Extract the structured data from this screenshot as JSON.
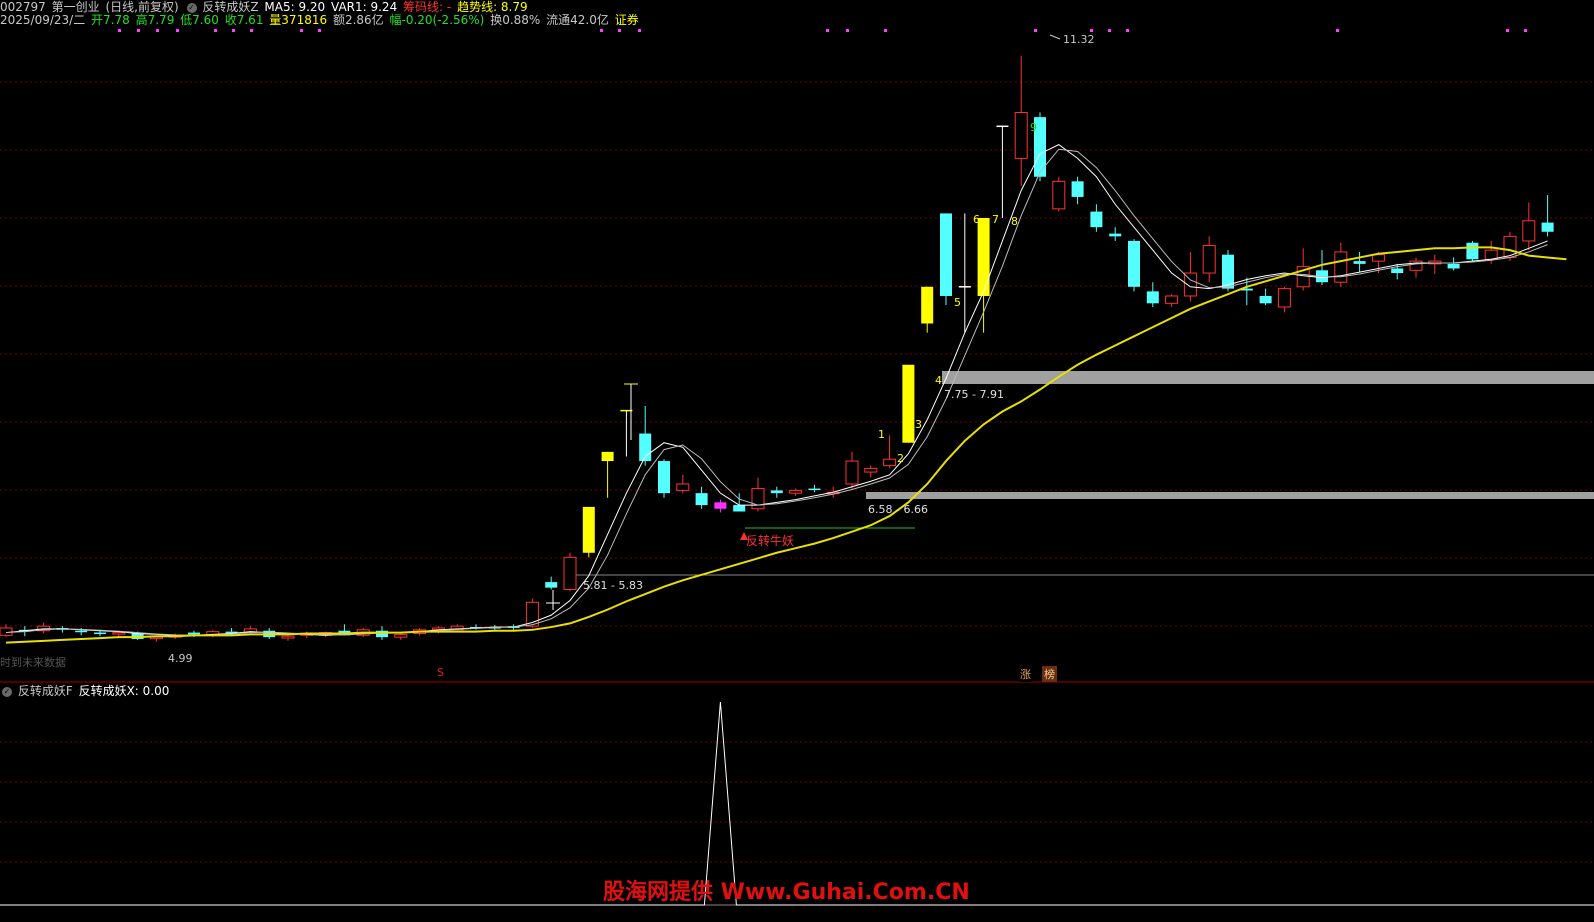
{
  "header": {
    "code": "002797",
    "name": "第一创业",
    "period": "(日线,前复权)",
    "indicator_name": "反转成妖Z",
    "ma5_label": "MA5: 9.20",
    "var1_label": "VAR1: 9.24",
    "chip_label": "筹码线: -",
    "trend_label": "趋势线: 8.79"
  },
  "quote": {
    "date": "2025/09/23/二",
    "open": "开7.78",
    "high": "高7.79",
    "low": "低7.60",
    "close": "收7.61",
    "volume": "量371816",
    "amount": "额2.86亿",
    "change": "幅-0.20(-2.56%)",
    "turnover": "换0.88%",
    "float": "流通42.0亿",
    "sector": "证券"
  },
  "sub_header": {
    "indicator": "反转成妖F",
    "value_label": "反转成妖X: 0.00"
  },
  "annotations": {
    "max_price": "11.32",
    "min_price": "4.99",
    "zone1": "7.75 - 7.91",
    "zone2": "6.58 - 6.66",
    "zone3": "5.81 - 5.83",
    "signal": "反转牛妖",
    "nodata": "时到未来数据",
    "s_tag": "S",
    "zhang": "涨",
    "bang": "榜",
    "count_labels": [
      "1",
      "2",
      "3",
      "4",
      "5",
      "6",
      "7",
      "8",
      "9"
    ]
  },
  "watermark": "股海网提供 Www.Guhai.Com.CN",
  "colors": {
    "up": "#ff3232",
    "down": "#54ffff",
    "yellow_bar": "#ffff00",
    "trend_line": "#e8e000",
    "ma_line": "#ffffff",
    "grid": "#7a0000",
    "zone_band": "#a0a0a0",
    "header_red": "#ff3030",
    "header_yellow": "#ffff00",
    "header_green": "#20e020"
  },
  "chart_data": {
    "type": "candlestick",
    "price_range": [
      4.6,
      11.6
    ],
    "candles": [
      {
        "o": 5.0,
        "h": 5.12,
        "l": 4.98,
        "c": 5.08,
        "up": true
      },
      {
        "o": 5.06,
        "h": 5.1,
        "l": 4.99,
        "c": 5.04,
        "up": false
      },
      {
        "o": 5.05,
        "h": 5.14,
        "l": 5.02,
        "c": 5.1,
        "up": true
      },
      {
        "o": 5.08,
        "h": 5.1,
        "l": 5.03,
        "c": 5.06,
        "up": false
      },
      {
        "o": 5.05,
        "h": 5.08,
        "l": 5.0,
        "c": 5.04,
        "up": false
      },
      {
        "o": 5.03,
        "h": 5.06,
        "l": 4.99,
        "c": 5.02,
        "up": false
      },
      {
        "o": 5.02,
        "h": 5.05,
        "l": 4.98,
        "c": 5.03,
        "up": true
      },
      {
        "o": 5.02,
        "h": 5.04,
        "l": 4.95,
        "c": 4.96,
        "up": false
      },
      {
        "o": 4.97,
        "h": 5.0,
        "l": 4.93,
        "c": 4.98,
        "up": true
      },
      {
        "o": 4.98,
        "h": 5.02,
        "l": 4.96,
        "c": 5.0,
        "up": true
      },
      {
        "o": 5.01,
        "h": 5.05,
        "l": 4.98,
        "c": 5.03,
        "up": false
      },
      {
        "o": 5.0,
        "h": 5.06,
        "l": 4.98,
        "c": 5.04,
        "up": true
      },
      {
        "o": 5.04,
        "h": 5.08,
        "l": 5.0,
        "c": 5.02,
        "up": false
      },
      {
        "o": 5.03,
        "h": 5.1,
        "l": 5.01,
        "c": 5.07,
        "up": true
      },
      {
        "o": 5.05,
        "h": 5.08,
        "l": 4.96,
        "c": 4.98,
        "up": false
      },
      {
        "o": 4.97,
        "h": 5.0,
        "l": 4.94,
        "c": 4.99,
        "up": true
      },
      {
        "o": 5.0,
        "h": 5.04,
        "l": 4.97,
        "c": 5.02,
        "up": true
      },
      {
        "o": 5.0,
        "h": 5.04,
        "l": 4.98,
        "c": 5.03,
        "up": true
      },
      {
        "o": 5.05,
        "h": 5.12,
        "l": 5.0,
        "c": 5.0,
        "up": false
      },
      {
        "o": 5.0,
        "h": 5.08,
        "l": 4.98,
        "c": 5.06,
        "up": true
      },
      {
        "o": 5.05,
        "h": 5.1,
        "l": 4.95,
        "c": 4.98,
        "up": false
      },
      {
        "o": 4.98,
        "h": 5.02,
        "l": 4.95,
        "c": 5.01,
        "up": true
      },
      {
        "o": 5.02,
        "h": 5.08,
        "l": 5.0,
        "c": 5.06,
        "up": true
      },
      {
        "o": 5.06,
        "h": 5.1,
        "l": 5.02,
        "c": 5.08,
        "up": true
      },
      {
        "o": 5.06,
        "h": 5.12,
        "l": 5.04,
        "c": 5.1,
        "up": true
      },
      {
        "o": 5.09,
        "h": 5.12,
        "l": 5.06,
        "c": 5.08,
        "up": false
      },
      {
        "o": 5.08,
        "h": 5.11,
        "l": 5.06,
        "c": 5.09,
        "up": false
      },
      {
        "o": 5.08,
        "h": 5.12,
        "l": 5.06,
        "c": 5.1,
        "up": false
      },
      {
        "o": 5.1,
        "h": 5.4,
        "l": 5.08,
        "c": 5.36,
        "up": true
      },
      {
        "o": 5.52,
        "h": 5.64,
        "l": 5.5,
        "c": 5.58,
        "up": false
      },
      {
        "o": 5.5,
        "h": 5.9,
        "l": 5.48,
        "c": 5.85,
        "up": true
      },
      {
        "o": 5.9,
        "h": 6.4,
        "l": 5.85,
        "c": 6.4,
        "up": true,
        "yellow": true
      },
      {
        "o": 7.0,
        "h": 7.0,
        "l": 6.5,
        "c": 6.9,
        "up": true,
        "yellow": true
      },
      {
        "o": 7.45,
        "h": 7.45,
        "l": 6.95,
        "c": 7.45,
        "up": true,
        "flat": true
      },
      {
        "o": 7.2,
        "h": 7.5,
        "l": 6.85,
        "c": 6.9,
        "up": false
      },
      {
        "o": 6.9,
        "h": 6.92,
        "l": 6.5,
        "c": 6.55,
        "up": false
      },
      {
        "o": 6.65,
        "h": 6.75,
        "l": 6.55,
        "c": 6.58,
        "up": true
      },
      {
        "o": 6.55,
        "h": 6.62,
        "l": 6.38,
        "c": 6.42,
        "up": false
      },
      {
        "o": 6.38,
        "h": 6.48,
        "l": 6.34,
        "c": 6.45,
        "up": true,
        "magenta": true
      },
      {
        "o": 6.42,
        "h": 6.55,
        "l": 6.35,
        "c": 6.35,
        "up": false
      },
      {
        "o": 6.38,
        "h": 6.72,
        "l": 6.35,
        "c": 6.6,
        "up": true
      },
      {
        "o": 6.58,
        "h": 6.62,
        "l": 6.5,
        "c": 6.55,
        "up": false
      },
      {
        "o": 6.55,
        "h": 6.6,
        "l": 6.52,
        "c": 6.58,
        "up": true
      },
      {
        "o": 6.6,
        "h": 6.64,
        "l": 6.56,
        "c": 6.6,
        "up": false
      },
      {
        "o": 6.56,
        "h": 6.62,
        "l": 6.5,
        "c": 6.55,
        "up": true
      },
      {
        "o": 6.65,
        "h": 7.0,
        "l": 6.6,
        "c": 6.9,
        "up": true
      },
      {
        "o": 6.78,
        "h": 6.85,
        "l": 6.72,
        "c": 6.82,
        "up": true
      },
      {
        "o": 6.85,
        "h": 7.18,
        "l": 6.82,
        "c": 6.92,
        "up": true
      },
      {
        "o": 7.1,
        "h": 7.95,
        "l": 7.1,
        "c": 7.95,
        "up": true,
        "yellow": true
      },
      {
        "o": 8.4,
        "h": 8.8,
        "l": 8.3,
        "c": 8.8,
        "up": true,
        "yellow": true
      },
      {
        "o": 9.6,
        "h": 9.6,
        "l": 8.6,
        "c": 8.7,
        "up": false
      },
      {
        "o": 8.8,
        "h": 9.6,
        "l": 8.3,
        "c": 8.8,
        "up": false,
        "flat": true
      },
      {
        "o": 8.7,
        "h": 9.55,
        "l": 8.3,
        "c": 9.55,
        "up": true,
        "yellow": true
      },
      {
        "o": 9.55,
        "h": 10.55,
        "l": 9.55,
        "c": 10.55,
        "up": false,
        "flat": true
      },
      {
        "o": 10.2,
        "h": 11.32,
        "l": 9.9,
        "c": 10.7,
        "up": true
      },
      {
        "o": 10.65,
        "h": 10.7,
        "l": 9.95,
        "c": 10.0,
        "up": false
      },
      {
        "o": 9.65,
        "h": 10.0,
        "l": 9.62,
        "c": 9.95,
        "up": true
      },
      {
        "o": 9.95,
        "h": 10.0,
        "l": 9.7,
        "c": 9.78,
        "up": false
      },
      {
        "o": 9.62,
        "h": 9.7,
        "l": 9.4,
        "c": 9.45,
        "up": false
      },
      {
        "o": 9.35,
        "h": 9.45,
        "l": 9.3,
        "c": 9.38,
        "up": false
      },
      {
        "o": 9.3,
        "h": 9.32,
        "l": 8.75,
        "c": 8.8,
        "up": false
      },
      {
        "o": 8.75,
        "h": 8.85,
        "l": 8.58,
        "c": 8.62,
        "up": false
      },
      {
        "o": 8.62,
        "h": 8.72,
        "l": 8.58,
        "c": 8.7,
        "up": true
      },
      {
        "o": 8.7,
        "h": 9.18,
        "l": 8.64,
        "c": 8.95,
        "up": true
      },
      {
        "o": 8.95,
        "h": 9.35,
        "l": 8.85,
        "c": 9.25,
        "up": true
      },
      {
        "o": 9.15,
        "h": 9.2,
        "l": 8.75,
        "c": 8.78,
        "up": false
      },
      {
        "o": 8.78,
        "h": 8.9,
        "l": 8.6,
        "c": 8.76,
        "up": false
      },
      {
        "o": 8.7,
        "h": 8.78,
        "l": 8.6,
        "c": 8.62,
        "up": false
      },
      {
        "o": 8.58,
        "h": 8.8,
        "l": 8.52,
        "c": 8.78,
        "up": true
      },
      {
        "o": 8.8,
        "h": 9.22,
        "l": 8.76,
        "c": 9.02,
        "up": true
      },
      {
        "o": 8.98,
        "h": 9.2,
        "l": 8.82,
        "c": 8.85,
        "up": false
      },
      {
        "o": 8.85,
        "h": 9.28,
        "l": 8.8,
        "c": 9.18,
        "up": true
      },
      {
        "o": 9.08,
        "h": 9.18,
        "l": 8.96,
        "c": 9.05,
        "up": false
      },
      {
        "o": 9.08,
        "h": 9.18,
        "l": 8.95,
        "c": 9.15,
        "up": true
      },
      {
        "o": 8.95,
        "h": 9.05,
        "l": 8.88,
        "c": 9.0,
        "up": false
      },
      {
        "o": 8.98,
        "h": 9.12,
        "l": 8.9,
        "c": 9.08,
        "up": true
      },
      {
        "o": 9.08,
        "h": 9.15,
        "l": 8.94,
        "c": 9.05,
        "up": true
      },
      {
        "o": 9.05,
        "h": 9.12,
        "l": 8.98,
        "c": 9.0,
        "up": false
      },
      {
        "o": 9.1,
        "h": 9.3,
        "l": 9.08,
        "c": 9.28,
        "up": false
      },
      {
        "o": 9.1,
        "h": 9.3,
        "l": 9.05,
        "c": 9.2,
        "up": true
      },
      {
        "o": 9.12,
        "h": 9.4,
        "l": 9.08,
        "c": 9.35,
        "up": true
      },
      {
        "o": 9.3,
        "h": 9.72,
        "l": 9.2,
        "c": 9.52,
        "up": true
      },
      {
        "o": 9.5,
        "h": 9.8,
        "l": 9.35,
        "c": 9.4,
        "up": false
      }
    ],
    "trend": [
      4.92,
      4.93,
      4.94,
      4.95,
      4.96,
      4.97,
      4.98,
      4.98,
      4.99,
      4.99,
      5.0,
      5.0,
      5.0,
      5.01,
      5.01,
      5.01,
      5.02,
      5.02,
      5.02,
      5.03,
      5.03,
      5.03,
      5.04,
      5.04,
      5.04,
      5.04,
      5.05,
      5.05,
      5.06,
      5.09,
      5.13,
      5.2,
      5.28,
      5.37,
      5.45,
      5.53,
      5.6,
      5.66,
      5.72,
      5.78,
      5.84,
      5.9,
      5.95,
      6.0,
      6.06,
      6.13,
      6.2,
      6.3,
      6.45,
      6.65,
      6.9,
      7.12,
      7.3,
      7.44,
      7.55,
      7.68,
      7.82,
      7.95,
      8.06,
      8.16,
      8.26,
      8.36,
      8.46,
      8.56,
      8.64,
      8.72,
      8.8,
      8.86,
      8.92,
      8.98,
      9.04,
      9.08,
      9.12,
      9.16,
      9.18,
      9.2,
      9.22,
      9.22,
      9.23,
      9.23,
      9.2,
      9.14,
      9.12,
      9.1
    ],
    "ma5": [
      5.03,
      5.05,
      5.07,
      5.07,
      5.06,
      5.05,
      5.04,
      5.02,
      5.01,
      5.0,
      5.0,
      5.01,
      5.02,
      5.04,
      5.03,
      5.02,
      5.01,
      5.0,
      5.01,
      5.02,
      5.03,
      5.03,
      5.04,
      5.06,
      5.07,
      5.08,
      5.09,
      5.09,
      5.14,
      5.22,
      5.38,
      5.65,
      6.1,
      6.55,
      6.95,
      7.1,
      7.05,
      6.8,
      6.55,
      6.42,
      6.42,
      6.45,
      6.48,
      6.52,
      6.56,
      6.62,
      6.68,
      6.75,
      6.98,
      7.35,
      7.8,
      8.3,
      8.75,
      9.3,
      9.85,
      10.25,
      10.35,
      10.2,
      10.0,
      9.7,
      9.45,
      9.2,
      8.95,
      8.8,
      8.78,
      8.82,
      8.88,
      8.92,
      8.95,
      8.92,
      8.9,
      8.92,
      8.96,
      9.0,
      9.04,
      9.06,
      9.06,
      9.06,
      9.08,
      9.1,
      9.14,
      9.22,
      9.3
    ]
  },
  "indicator_data": {
    "type": "line",
    "range": [
      0,
      1
    ],
    "spike_index": 38,
    "values_note": "zero except single spike"
  }
}
